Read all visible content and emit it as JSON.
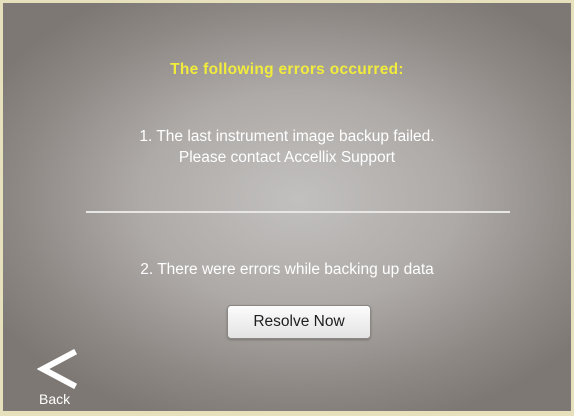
{
  "dialog": {
    "title": "The following errors occurred:",
    "error1_line1": "1. The last instrument image backup failed.",
    "error1_line2": "Please contact Accellix Support",
    "error2": "2. There were errors while backing up data",
    "resolve_label": "Resolve Now"
  },
  "nav": {
    "back_label": "Back",
    "back_icon": "chevron-left-icon"
  },
  "colors": {
    "title": "#f1ec3c",
    "border": "#e7e0bd",
    "text": "#ffffff"
  }
}
